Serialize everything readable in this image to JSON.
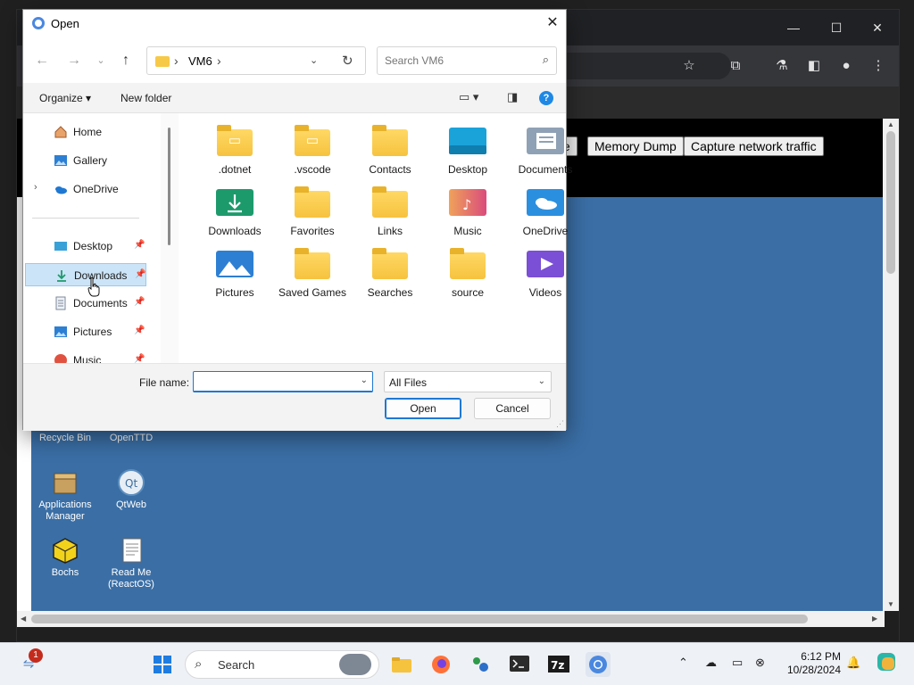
{
  "browser": {
    "vm_buttons": [
      "te",
      "Memory Dump",
      "Capture network traffic"
    ],
    "desktop_icons": [
      {
        "label": "Recycle Bin"
      },
      {
        "label": "OpenTTD"
      },
      {
        "label": "Applications Manager"
      },
      {
        "label": "QtWeb"
      },
      {
        "label": "Bochs"
      },
      {
        "label": "Read Me (ReactOS)"
      }
    ]
  },
  "dialog": {
    "title": "Open",
    "address": {
      "crumb": "VM6",
      "separator": "›"
    },
    "search": {
      "placeholder": "Search VM6"
    },
    "commands": {
      "organize": "Organize ▾",
      "new_folder": "New folder"
    },
    "nav_items": [
      {
        "label": "Home",
        "icon": "home-icon",
        "pinned": false
      },
      {
        "label": "Gallery",
        "icon": "gallery-icon",
        "pinned": false
      },
      {
        "label": "OneDrive",
        "icon": "onedrive-icon",
        "pinned": false
      },
      {
        "label": "Desktop",
        "icon": "desktop-icon",
        "pinned": true
      },
      {
        "label": "Downloads",
        "icon": "downloads-icon",
        "pinned": true
      },
      {
        "label": "Documents",
        "icon": "documents-icon",
        "pinned": true
      },
      {
        "label": "Pictures",
        "icon": "pictures-icon",
        "pinned": true
      },
      {
        "label": "Music",
        "icon": "music-icon",
        "pinned": true
      }
    ],
    "files": [
      {
        "name": ".dotnet",
        "icon": "folder-icon"
      },
      {
        "name": ".vscode",
        "icon": "folder-icon"
      },
      {
        "name": "Contacts",
        "icon": "folder-icon"
      },
      {
        "name": "Desktop",
        "icon": "desktop-folder-icon"
      },
      {
        "name": "Documents",
        "icon": "documents-folder-icon"
      },
      {
        "name": "Downloads",
        "icon": "downloads-folder-icon"
      },
      {
        "name": "Favorites",
        "icon": "folder-icon"
      },
      {
        "name": "Links",
        "icon": "folder-icon"
      },
      {
        "name": "Music",
        "icon": "music-folder-icon"
      },
      {
        "name": "OneDrive",
        "icon": "onedrive-folder-icon"
      },
      {
        "name": "Pictures",
        "icon": "pictures-folder-icon"
      },
      {
        "name": "Saved Games",
        "icon": "folder-icon"
      },
      {
        "name": "Searches",
        "icon": "folder-icon"
      },
      {
        "name": "source",
        "icon": "folder-icon"
      },
      {
        "name": "Videos",
        "icon": "videos-folder-icon"
      }
    ],
    "file_name_label": "File name:",
    "file_name_value": "",
    "file_type": "All Files",
    "open_button": "Open",
    "cancel_button": "Cancel"
  },
  "taskbar": {
    "search_label": "Search",
    "notification_count": "1",
    "time": "6:12 PM",
    "date": "10/28/2024"
  },
  "colors": {
    "accent": "#1e78d3",
    "desktop": "#3a6ea5",
    "selection": "#cce4f7"
  }
}
